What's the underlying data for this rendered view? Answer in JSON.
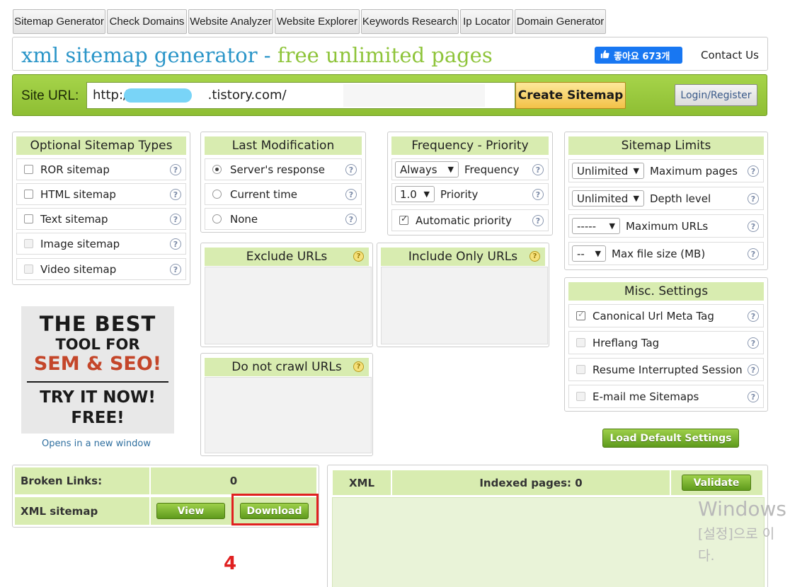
{
  "tabs": [
    "Sitemap Generator",
    "Check Domains",
    "Website Analyzer",
    "Website Explorer",
    "Keywords Research",
    "Ip Locator",
    "Domain Generator"
  ],
  "header": {
    "title_main": "xml sitemap generator",
    "title_sep": " - ",
    "title_accent": "free unlimited pages",
    "like_label": "좋아요 673개",
    "contact_label": "Contact Us"
  },
  "urlbar": {
    "label": "Site URL:",
    "value_prefix": "http://",
    "value_suffix": ".tistory.com/",
    "create_label": "Create Sitemap",
    "login_label": "Login/Register"
  },
  "optional_types": {
    "title": "Optional Sitemap Types",
    "items": [
      "ROR sitemap",
      "HTML sitemap",
      "Text sitemap",
      "Image sitemap",
      "Video sitemap"
    ]
  },
  "last_mod": {
    "title": "Last Modification",
    "options": [
      "Server's response",
      "Current time",
      "None"
    ],
    "selected": "Server's response"
  },
  "freq": {
    "title": "Frequency - Priority",
    "frequency_value": "Always",
    "frequency_label": "Frequency",
    "priority_value": "1.0",
    "priority_label": "Priority",
    "auto_label": "Automatic priority"
  },
  "limits": {
    "title": "Sitemap Limits",
    "max_pages_value": "Unlimited",
    "max_pages_label": "Maximum pages",
    "depth_value": "Unlimited",
    "depth_label": "Depth level",
    "max_urls_value": "-----",
    "max_urls_label": "Maximum URLs",
    "max_size_value": "--",
    "max_size_label": "Max file size (MB)"
  },
  "exclude": {
    "title": "Exclude URLs"
  },
  "include_only": {
    "title": "Include Only URLs"
  },
  "no_crawl": {
    "title": "Do not crawl URLs"
  },
  "misc": {
    "title": "Misc. Settings",
    "items": [
      "Canonical Url Meta Tag",
      "Hreflang Tag",
      "Resume Interrupted Session",
      "E-mail me Sitemaps"
    ]
  },
  "load_defaults_label": "Load Default Settings",
  "ad": {
    "line1": "THE BEST",
    "line2": "TOOL FOR",
    "line3": "SEM & SEO!",
    "line4": "TRY IT NOW!",
    "line5": "FREE!",
    "caption": "Opens in a new window"
  },
  "stats": {
    "broken_links_label": "Broken Links:",
    "broken_links_value": "0",
    "xml_sitemap_label": "XML sitemap",
    "view_label": "View",
    "download_label": "Download"
  },
  "results": {
    "xml_label": "XML",
    "indexed_label": "Indexed pages: 0",
    "validate_label": "Validate"
  },
  "annotation_step": "4",
  "watermark": {
    "line1": "Windows",
    "line2": "[설정]으로 이",
    "line3": "다."
  },
  "colors": {
    "accent_green": "#8ec43a",
    "title_blue": "#2a95c8",
    "highlight_red": "#e02020",
    "facebook_blue": "#1877f2"
  }
}
